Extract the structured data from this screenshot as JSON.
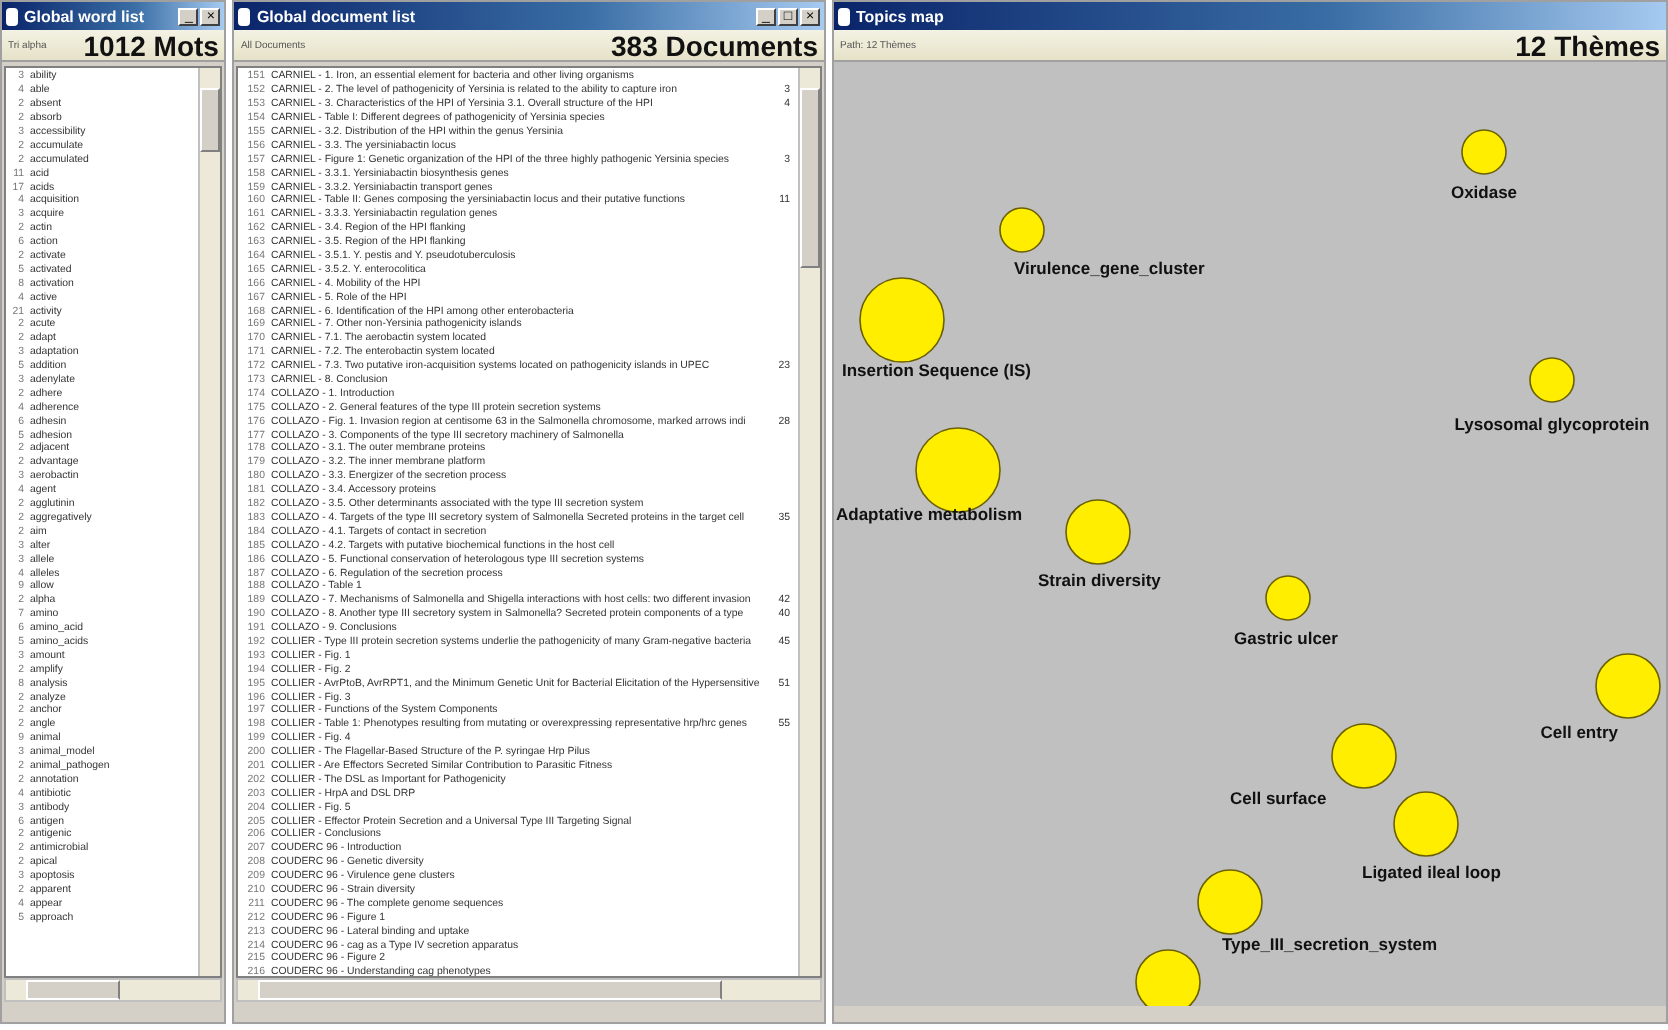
{
  "word_window": {
    "title": "Global word list",
    "controls": [
      "_",
      "×"
    ],
    "filter": "Tri alpha",
    "count": "1012 Mots",
    "rows": [
      {
        "n": "3",
        "word": "ability"
      },
      {
        "n": "4",
        "word": "able"
      },
      {
        "n": "2",
        "word": "absent"
      },
      {
        "n": "2",
        "word": "absorb"
      },
      {
        "n": "3",
        "word": "accessibility"
      },
      {
        "n": "2",
        "word": "accumulate"
      },
      {
        "n": "2",
        "word": "accumulated"
      },
      {
        "n": "11",
        "word": "acid"
      },
      {
        "n": "17",
        "word": "acids"
      },
      {
        "n": "4",
        "word": "acquisition"
      },
      {
        "n": "3",
        "word": "acquire"
      },
      {
        "n": "2",
        "word": "actin"
      },
      {
        "n": "6",
        "word": "action"
      },
      {
        "n": "2",
        "word": "activate"
      },
      {
        "n": "5",
        "word": "activated"
      },
      {
        "n": "8",
        "word": "activation"
      },
      {
        "n": "4",
        "word": "active"
      },
      {
        "n": "21",
        "word": "activity"
      },
      {
        "n": "2",
        "word": "acute"
      },
      {
        "n": "2",
        "word": "adapt"
      },
      {
        "n": "3",
        "word": "adaptation"
      },
      {
        "n": "5",
        "word": "addition"
      },
      {
        "n": "3",
        "word": "adenylate"
      },
      {
        "n": "2",
        "word": "adhere"
      },
      {
        "n": "4",
        "word": "adherence"
      },
      {
        "n": "6",
        "word": "adhesin"
      },
      {
        "n": "5",
        "word": "adhesion"
      },
      {
        "n": "2",
        "word": "adjacent"
      },
      {
        "n": "2",
        "word": "advantage"
      },
      {
        "n": "3",
        "word": "aerobactin"
      },
      {
        "n": "4",
        "word": "agent"
      },
      {
        "n": "2",
        "word": "agglutinin"
      },
      {
        "n": "2",
        "word": "aggregatively"
      },
      {
        "n": "2",
        "word": "aim"
      },
      {
        "n": "3",
        "word": "alter"
      },
      {
        "n": "3",
        "word": "allele"
      },
      {
        "n": "4",
        "word": "alleles"
      },
      {
        "n": "9",
        "word": "allow"
      },
      {
        "n": "2",
        "word": "alpha"
      },
      {
        "n": "7",
        "word": "amino"
      },
      {
        "n": "6",
        "word": "amino_acid"
      },
      {
        "n": "5",
        "word": "amino_acids"
      },
      {
        "n": "3",
        "word": "amount"
      },
      {
        "n": "2",
        "word": "amplify"
      },
      {
        "n": "8",
        "word": "analysis"
      },
      {
        "n": "2",
        "word": "analyze"
      },
      {
        "n": "2",
        "word": "anchor"
      },
      {
        "n": "2",
        "word": "angle"
      },
      {
        "n": "9",
        "word": "animal"
      },
      {
        "n": "3",
        "word": "animal_model"
      },
      {
        "n": "2",
        "word": "animal_pathogen"
      },
      {
        "n": "2",
        "word": "annotation"
      },
      {
        "n": "4",
        "word": "antibiotic"
      },
      {
        "n": "3",
        "word": "antibody"
      },
      {
        "n": "6",
        "word": "antigen"
      },
      {
        "n": "2",
        "word": "antigenic"
      },
      {
        "n": "2",
        "word": "antimicrobial"
      },
      {
        "n": "2",
        "word": "apical"
      },
      {
        "n": "3",
        "word": "apoptosis"
      },
      {
        "n": "2",
        "word": "apparent"
      },
      {
        "n": "4",
        "word": "appear"
      },
      {
        "n": "5",
        "word": "approach"
      }
    ]
  },
  "document_window": {
    "title": "Global document list",
    "controls": [
      "_",
      "□",
      "×"
    ],
    "filter": "All Documents",
    "count": "383 Documents",
    "rows": [
      {
        "n": "151",
        "text": "CARNIEL - 1. Iron, an essential element for bacteria and other living organisms"
      },
      {
        "n": "152",
        "text": "CARNIEL - 2. The level of pathogenicity of Yersinia is related to the ability to capture iron",
        "score": "3"
      },
      {
        "n": "153",
        "text": "CARNIEL - 3. Characteristics of the HPI of Yersinia 3.1. Overall structure of the HPI",
        "score": "4"
      },
      {
        "n": "154",
        "text": "CARNIEL - Table I: Different degrees of pathogenicity of Yersinia species"
      },
      {
        "n": "155",
        "text": "CARNIEL - 3.2. Distribution of the HPI within the genus Yersinia"
      },
      {
        "n": "156",
        "text": "CARNIEL - 3.3. The yersiniabactin locus"
      },
      {
        "n": "157",
        "text": "CARNIEL - Figure 1: Genetic organization of the HPI of the three highly pathogenic Yersinia species",
        "score": "3"
      },
      {
        "n": "158",
        "text": "CARNIEL - 3.3.1. Yersiniabactin biosynthesis genes"
      },
      {
        "n": "159",
        "text": "CARNIEL - 3.3.2. Yersiniabactin transport genes"
      },
      {
        "n": "160",
        "text": "CARNIEL - Table II: Genes composing the yersiniabactin locus and their putative functions",
        "score": "11"
      },
      {
        "n": "161",
        "text": "CARNIEL - 3.3.3. Yersiniabactin regulation genes"
      },
      {
        "n": "162",
        "text": "CARNIEL - 3.4. Region of the HPI flanking"
      },
      {
        "n": "163",
        "text": "CARNIEL - 3.5. Region of the HPI flanking"
      },
      {
        "n": "164",
        "text": "CARNIEL - 3.5.1. Y. pestis and Y. pseudotuberculosis"
      },
      {
        "n": "165",
        "text": "CARNIEL - 3.5.2. Y. enterocolitica"
      },
      {
        "n": "166",
        "text": "CARNIEL - 4. Mobility of the HPI"
      },
      {
        "n": "167",
        "text": "CARNIEL - 5. Role of the HPI"
      },
      {
        "n": "168",
        "text": "CARNIEL - 6. Identification of the HPI among other enterobacteria"
      },
      {
        "n": "169",
        "text": "CARNIEL - 7. Other non-Yersinia pathogenicity islands"
      },
      {
        "n": "170",
        "text": "CARNIEL - 7.1. The aerobactin system located"
      },
      {
        "n": "171",
        "text": "CARNIEL - 7.2. The enterobactin system located"
      },
      {
        "n": "172",
        "text": "CARNIEL - 7.3. Two putative iron-acquisition systems located on pathogenicity islands in UPEC",
        "score": "23"
      },
      {
        "n": "173",
        "text": "CARNIEL - 8. Conclusion"
      },
      {
        "n": "174",
        "text": "COLLAZO - 1. Introduction"
      },
      {
        "n": "175",
        "text": "COLLAZO - 2. General features of the type III protein secretion systems"
      },
      {
        "n": "176",
        "text": "COLLAZO - Fig. 1. Invasion region at centisome 63 in the Salmonella chromosome, marked arrows indi",
        "score": "28"
      },
      {
        "n": "177",
        "text": "COLLAZO - 3. Components of the type III secretory machinery of Salmonella"
      },
      {
        "n": "178",
        "text": "COLLAZO - 3.1. The outer membrane proteins"
      },
      {
        "n": "179",
        "text": "COLLAZO - 3.2. The inner membrane platform"
      },
      {
        "n": "180",
        "text": "COLLAZO - 3.3. Energizer of the secretion process"
      },
      {
        "n": "181",
        "text": "COLLAZO - 3.4. Accessory proteins"
      },
      {
        "n": "182",
        "text": "COLLAZO - 3.5. Other determinants associated with the type III secretion system"
      },
      {
        "n": "183",
        "text": "COLLAZO - 4. Targets of the type III secretory system of Salmonella Secreted proteins in the target cell",
        "score": "35"
      },
      {
        "n": "184",
        "text": "COLLAZO - 4.1. Targets of contact in secretion"
      },
      {
        "n": "185",
        "text": "COLLAZO - 4.2. Targets with putative biochemical functions in the host cell"
      },
      {
        "n": "186",
        "text": "COLLAZO - 5. Functional conservation of heterologous type III secretion systems"
      },
      {
        "n": "187",
        "text": "COLLAZO - 6. Regulation of the secretion process"
      },
      {
        "n": "188",
        "text": "COLLAZO - Table 1"
      },
      {
        "n": "189",
        "text": "COLLAZO - 7. Mechanisms of Salmonella and Shigella interactions with host cells: two different invasion",
        "score": "42"
      },
      {
        "n": "190",
        "text": "COLLAZO - 8. Another type III secretory system in Salmonella? Secreted protein components of a type",
        "score": "40"
      },
      {
        "n": "191",
        "text": "COLLAZO - 9. Conclusions"
      },
      {
        "n": "192",
        "text": "COLLIER - Type III protein secretion systems underlie the pathogenicity of many Gram-negative bacteria",
        "score": "45"
      },
      {
        "n": "193",
        "text": "COLLIER - Fig. 1"
      },
      {
        "n": "194",
        "text": "COLLIER - Fig. 2"
      },
      {
        "n": "195",
        "text": "COLLIER - AvrPtoB, AvrRPT1, and the Minimum Genetic Unit for Bacterial Elicitation of the Hypersensitive",
        "score": "51"
      },
      {
        "n": "196",
        "text": "COLLIER - Fig. 3"
      },
      {
        "n": "197",
        "text": "COLLIER - Functions of the System Components"
      },
      {
        "n": "198",
        "text": "COLLIER - Table 1: Phenotypes resulting from mutating or overexpressing representative hrp/hrc genes",
        "score": "55"
      },
      {
        "n": "199",
        "text": "COLLIER - Fig. 4"
      },
      {
        "n": "200",
        "text": "COLLIER - The Flagellar-Based Structure of the P. syringae Hrp Pilus"
      },
      {
        "n": "201",
        "text": "COLLIER - Are Effectors Secreted Similar Contribution to Parasitic Fitness"
      },
      {
        "n": "202",
        "text": "COLLIER - The DSL as Important for Pathogenicity"
      },
      {
        "n": "203",
        "text": "COLLIER - HrpA and DSL DRP"
      },
      {
        "n": "204",
        "text": "COLLIER - Fig. 5"
      },
      {
        "n": "205",
        "text": "COLLIER - Effector Protein Secretion and a Universal Type III Targeting Signal"
      },
      {
        "n": "206",
        "text": "COLLIER - Conclusions"
      },
      {
        "n": "207",
        "text": "COUDERC 96 - Introduction"
      },
      {
        "n": "208",
        "text": "COUDERC 96 - Genetic diversity"
      },
      {
        "n": "209",
        "text": "COUDERC 96 - Virulence gene clusters"
      },
      {
        "n": "210",
        "text": "COUDERC 96 - Strain diversity"
      },
      {
        "n": "211",
        "text": "COUDERC 96 - The complete genome sequences"
      },
      {
        "n": "212",
        "text": "COUDERC 96 - Figure 1"
      },
      {
        "n": "213",
        "text": "COUDERC 96 - Lateral binding and uptake"
      },
      {
        "n": "214",
        "text": "COUDERC 96 - cag as a Type IV secretion apparatus"
      },
      {
        "n": "215",
        "text": "COUDERC 96 - Figure 2"
      },
      {
        "n": "216",
        "text": "COUDERC 96 - Understanding cag phenotypes"
      }
    ]
  },
  "topics_window": {
    "title": "Topics map",
    "path": "Path: 12 Thèmes",
    "count": "12 Thèmes",
    "themes": [
      {
        "label": "Oxidase"
      },
      {
        "label": "Virulence_gene_cluster"
      },
      {
        "label": "Insertion Sequence (IS)"
      },
      {
        "label": "Lysosomal glycoprotein"
      },
      {
        "label": "Adaptative metabolism"
      },
      {
        "label": "Strain diversity"
      },
      {
        "label": "Gastric ulcer"
      },
      {
        "label": "Cell entry"
      },
      {
        "label": "Cell surface"
      },
      {
        "label": "Ligated ileal loop"
      },
      {
        "label": "Type_III_secretion_system"
      },
      {
        "kind": "bubble"
      }
    ]
  }
}
